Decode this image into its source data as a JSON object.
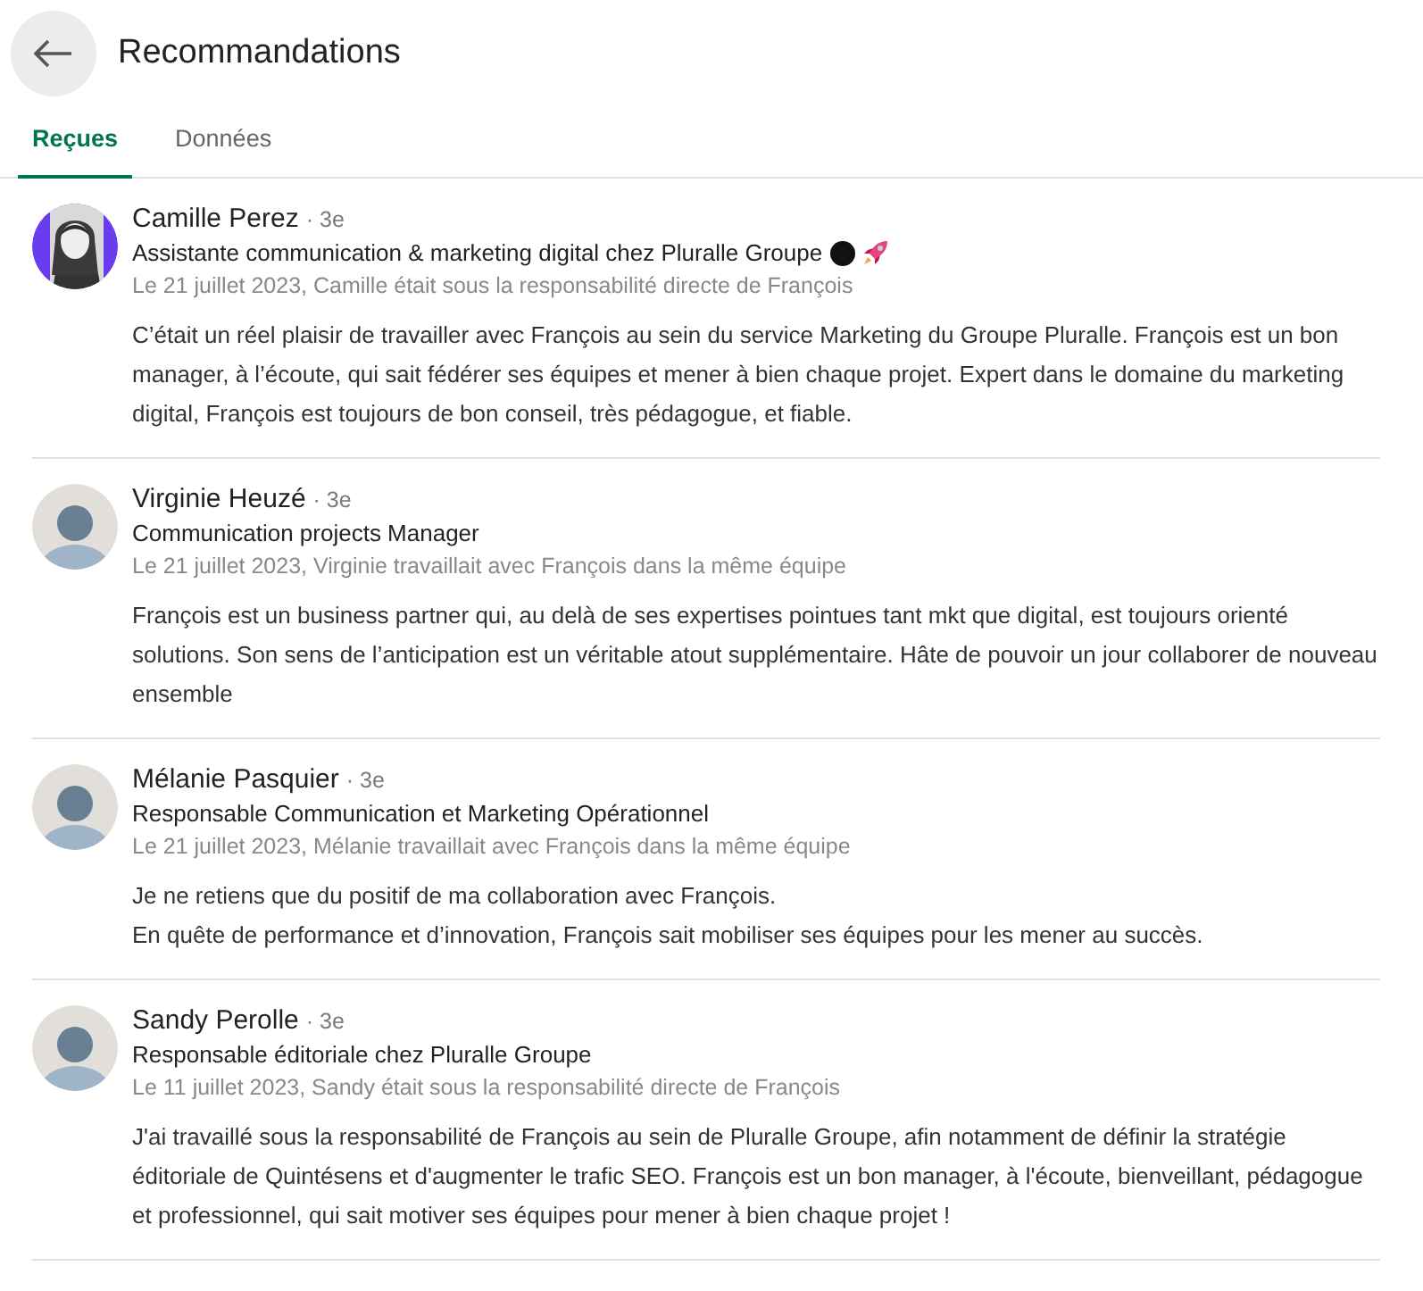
{
  "header": {
    "title": "Recommandations"
  },
  "tabs": [
    {
      "label": "Reçues",
      "selected": true
    },
    {
      "label": "Données",
      "selected": false
    }
  ],
  "recommendations": [
    {
      "name": "Camille Perez",
      "degree": "· 3e",
      "headline": "Assistante communication & marketing digital chez Pluralle Groupe",
      "headline_emoji": true,
      "context": "Le 21 juillet 2023, Camille était sous la responsabilité directe de François",
      "text": "C’était un réel plaisir de travailler avec François au sein du service Marketing du Groupe Pluralle. François est un bon manager, à l’écoute, qui sait fédérer ses équipes et mener à bien chaque projet. Expert dans le domaine du marketing digital, François est toujours de bon conseil, très pédagogue, et fiable."
    },
    {
      "name": "Virginie Heuzé",
      "degree": "· 3e",
      "avatar": {
        "kind": "default"
      },
      "headline": "Communication projects Manager",
      "context": "Le 21 juillet 2023, Virginie travaillait avec François dans la même équipe",
      "text": "François est un business partner qui, au delà de ses expertises pointues tant mkt que digital, est toujours orienté solutions. Son sens de l’anticipation est un véritable atout supplémentaire. Hâte de pouvoir un jour collaborer de nouveau ensemble"
    },
    {
      "name": "Mélanie Pasquier",
      "degree": "· 3e",
      "avatar": {
        "kind": "default"
      },
      "headline": "Responsable Communication et Marketing Opérationnel",
      "context": "Le 21 juillet 2023, Mélanie travaillait avec François dans la même équipe",
      "text": "Je ne retiens que du positif de ma collaboration avec François.\nEn quête de performance et d’innovation, François sait mobiliser ses équipes pour les mener au succès."
    },
    {
      "name": "Sandy Perolle",
      "degree": "· 3e",
      "avatar": {
        "kind": "default"
      },
      "headline": "Responsable éditoriale chez Pluralle Groupe",
      "context": "Le 11 juillet 2023, Sandy était sous la responsabilité directe de François",
      "text": "J'ai travaillé sous la responsabilité de François au sein de Pluralle Groupe, afin notamment de définir la stratégie éditoriale de Quintésens et d'augmenter le trafic SEO. François est un bon manager, à l'écoute, bienveillant, pédagogue et professionnel, qui sait motiver ses équipes pour mener à bien chaque projet !"
    }
  ]
}
